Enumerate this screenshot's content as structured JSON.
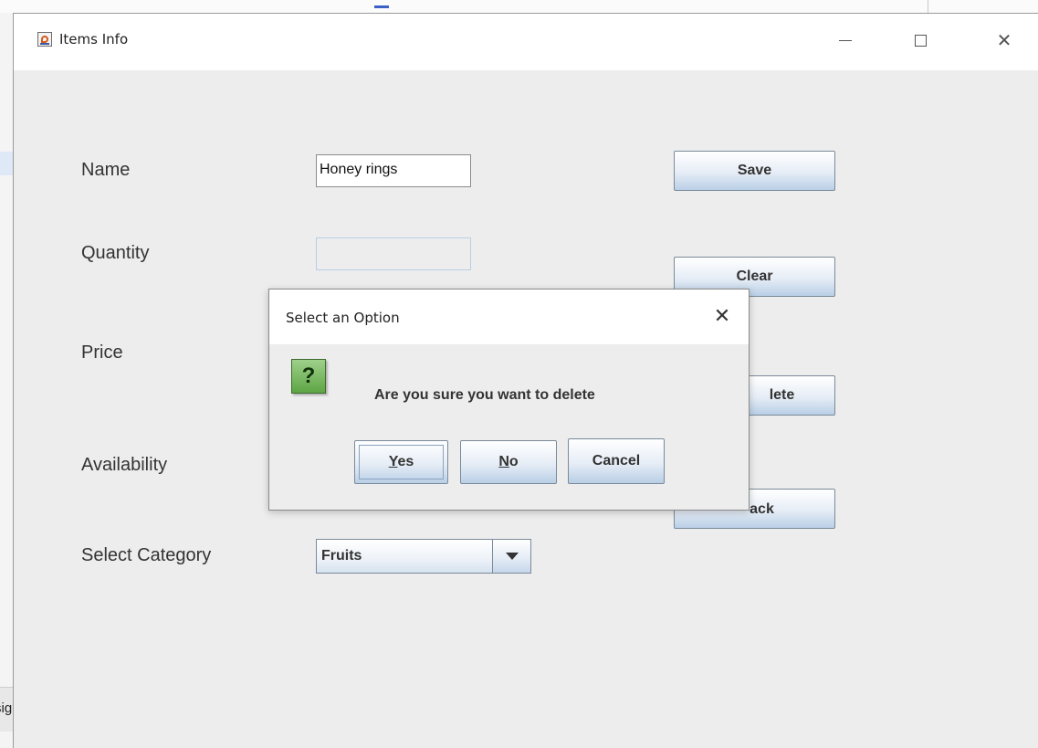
{
  "window": {
    "title": "Items Info"
  },
  "background": {
    "side_fragment": "sig"
  },
  "form": {
    "name_label": "Name",
    "name_value": "Honey rings",
    "quantity_label": "Quantity",
    "quantity_value": "",
    "price_label": "Price",
    "availability_label": "Availability",
    "category_label": "Select Category",
    "category_value": "Fruits"
  },
  "buttons": {
    "save": "Save",
    "clear": "Clear",
    "delete": "lete",
    "back": "ack"
  },
  "dialog": {
    "title": "Select an Option",
    "message": "Are you sure you want to delete",
    "icon_glyph": "?",
    "yes_mnemonic": "Y",
    "yes_rest": "es",
    "no_mnemonic": "N",
    "no_rest": "o",
    "cancel": "Cancel"
  },
  "icons": {
    "app": "java-app-icon",
    "minimize": "minimize-icon",
    "maximize": "maximize-icon",
    "close": "close-icon",
    "dialog_close": "close-icon",
    "question": "question-icon",
    "combo_arrow": "chevron-down-icon"
  },
  "colors": {
    "window_bg": "#ededed",
    "button_gradient_bottom": "#b9cfe6",
    "question_icon": "#5da544"
  }
}
